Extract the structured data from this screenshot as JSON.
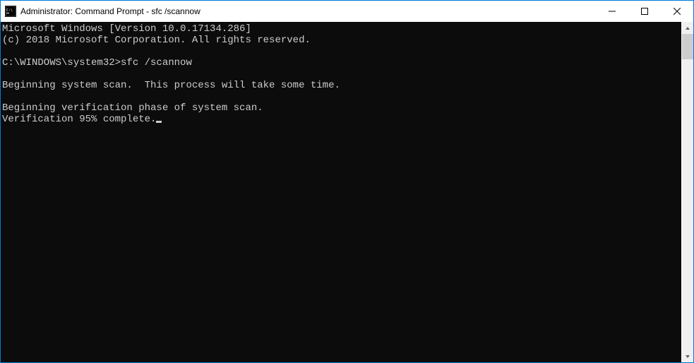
{
  "window": {
    "title": "Administrator: Command Prompt - sfc  /scannow"
  },
  "terminal": {
    "lines": [
      "Microsoft Windows [Version 10.0.17134.286]",
      "(c) 2018 Microsoft Corporation. All rights reserved.",
      "",
      "C:\\WINDOWS\\system32>sfc /scannow",
      "",
      "Beginning system scan.  This process will take some time.",
      "",
      "Beginning verification phase of system scan.",
      "Verification 95% complete."
    ],
    "progress_percent": 95
  }
}
